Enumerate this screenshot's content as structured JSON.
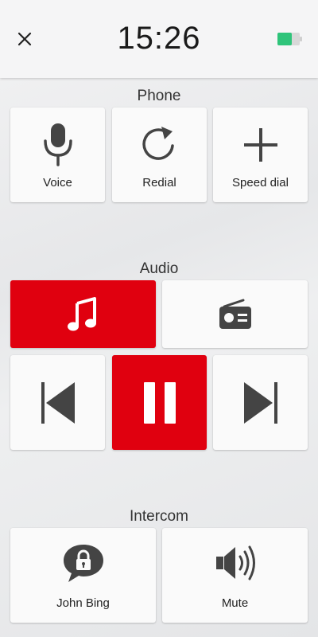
{
  "header": {
    "time": "15:26",
    "icons": {
      "close": "close-icon",
      "battery": "battery-icon"
    },
    "battery_color": "#2fc47a"
  },
  "phone": {
    "title": "Phone",
    "buttons": [
      {
        "label": "Voice",
        "icon": "microphone-icon"
      },
      {
        "label": "Redial",
        "icon": "redial-icon"
      },
      {
        "label": "Speed dial",
        "icon": "plus-icon"
      }
    ]
  },
  "audio": {
    "title": "Audio",
    "sources": [
      {
        "icon": "music-note-icon",
        "active": true
      },
      {
        "icon": "radio-icon",
        "active": false
      }
    ],
    "controls": [
      {
        "icon": "previous-track-icon",
        "active": false
      },
      {
        "icon": "pause-icon",
        "active": true
      },
      {
        "icon": "next-track-icon",
        "active": false
      }
    ]
  },
  "intercom": {
    "title": "Intercom",
    "buttons": [
      {
        "label": "John Bing",
        "icon": "locked-chat-icon"
      },
      {
        "label": "Mute",
        "icon": "speaker-icon"
      }
    ]
  },
  "colors": {
    "accent": "#e0000f",
    "tile": "#fafafa",
    "icon": "#444444"
  }
}
